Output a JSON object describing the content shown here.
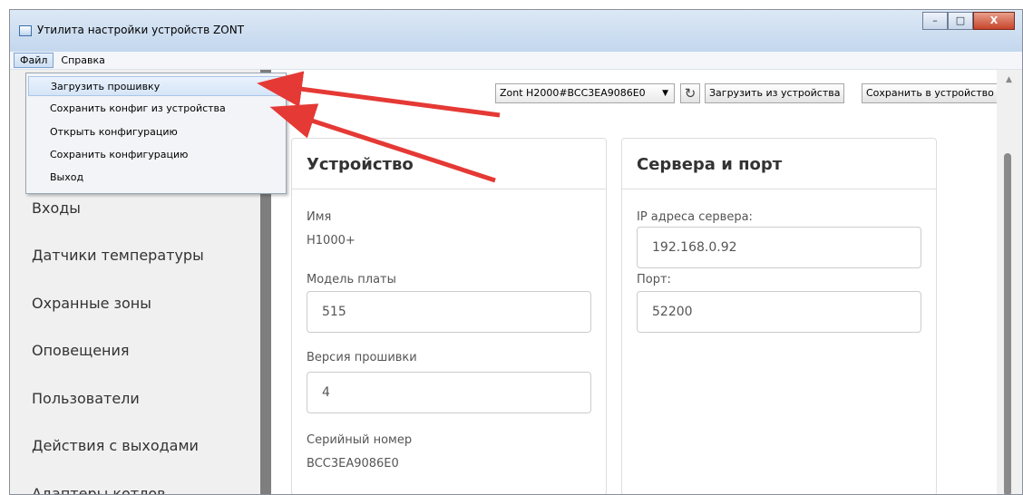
{
  "window": {
    "title": "Утилита настройки устройств ZONT",
    "controls": {
      "minimize": "–",
      "maximize": "□",
      "close": "X"
    }
  },
  "menubar": {
    "items": [
      "Файл",
      "Справка"
    ]
  },
  "file_menu": {
    "items": [
      "Загрузить прошивку",
      "Сохранить конфиг из устройства",
      "Открыть конфигурацию",
      "Сохранить конфигурацию",
      "Выход"
    ]
  },
  "sidebar": {
    "items": [
      "Входы",
      "Датчики температуры",
      "Охранные зоны",
      "Оповещения",
      "Пользователи",
      "Действия с выходами",
      "Адаптеры котлов"
    ]
  },
  "toolbar": {
    "device_select": "Zont H2000#BCC3EA9086E0",
    "refresh_icon": "↻",
    "load_button": "Загрузить из устройства",
    "save_button": "Сохранить в устройство"
  },
  "device_panel": {
    "title": "Устройство",
    "name_label": "Имя",
    "name_value": "H1000+",
    "board_label": "Модель платы",
    "board_value": "515",
    "firmware_label": "Версия прошивки",
    "firmware_value": "4",
    "serial_label": "Серийный номер",
    "serial_value": "BCC3EA9086E0"
  },
  "server_panel": {
    "title": "Сервера и порт",
    "ip_label": "IP адреса сервера:",
    "ip_value": "192.168.0.92",
    "port_label": "Порт:",
    "port_value": "52200"
  },
  "colors": {
    "annotation_arrow": "#e53935",
    "title_bar": "#c9dbf0"
  }
}
